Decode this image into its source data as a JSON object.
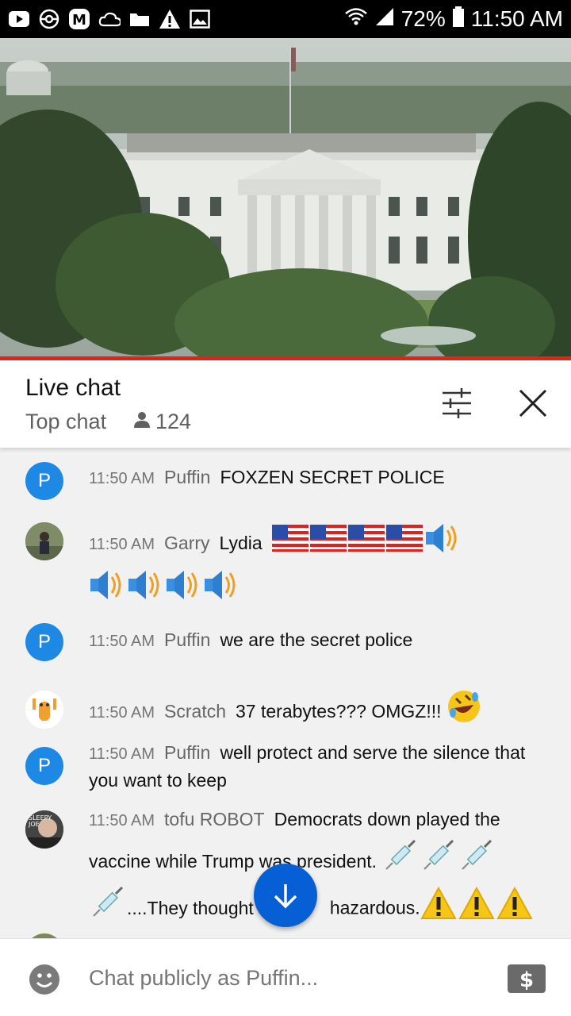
{
  "status": {
    "battery": "72%",
    "time": "11:50 AM"
  },
  "header": {
    "title": "Live chat",
    "mode": "Top chat",
    "viewers": "124"
  },
  "messages": [
    {
      "time": "11:50 AM",
      "author": "Puffin",
      "avatar": "P",
      "text": "FOXZEN SECRET POLICE"
    },
    {
      "time": "11:50 AM",
      "author": "Garry",
      "text": "Lydia"
    },
    {
      "time": "11:50 AM",
      "author": "Puffin",
      "avatar": "P",
      "text": "we are the secret police"
    },
    {
      "time": "11:50 AM",
      "author": "Scratch",
      "text": "37 terabytes??? OMGZ!!!"
    },
    {
      "time": "11:50 AM",
      "author": "Puffin",
      "avatar": "P",
      "text": "well protect and serve the silence that you want to keep"
    },
    {
      "time": "11:50 AM",
      "author": "tofu ROBOT",
      "text1": "Democrats down played the vaccine while Trump was president.",
      "text2": "....They thought",
      "text3": "hazardous."
    }
  ],
  "input": {
    "placeholder": "Chat publicly as Puffin..."
  },
  "colors": {
    "accent": "#065fd4",
    "progress": "#e62117",
    "avatar_blue": "#1e88e5"
  },
  "icons": [
    "youtube-icon",
    "pokeball-icon",
    "m-icon",
    "cloud-icon",
    "folder-icon",
    "warning-icon",
    "image-icon",
    "wifi-icon",
    "signal-icon",
    "battery-icon",
    "tune-icon",
    "close-icon",
    "person-icon",
    "flag-us-icon",
    "speaker-icon",
    "rofl-icon",
    "syringe-icon",
    "warning-emoji-icon",
    "arrow-down-icon",
    "smile-icon",
    "dollar-icon"
  ]
}
